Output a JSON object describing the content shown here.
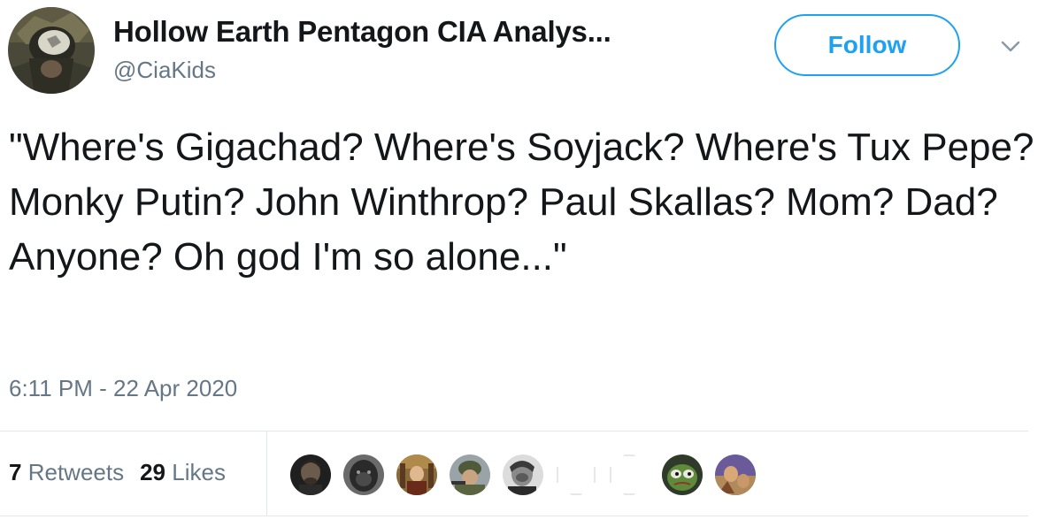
{
  "tweet": {
    "author": {
      "display_name": "Hollow Earth Pentagon CIA Analys...",
      "handle": "@CiaKids",
      "avatar_icon": "military-helmet-avatar"
    },
    "follow_label": "Follow",
    "menu_icon": "chevron-down-icon",
    "text": "\"Where's Gigachad? Where's Soyjack? Where's Tux Pepe? Monky Putin? John Winthrop? Paul Skallas? Mom? Dad? Anyone? Oh god I'm so alone...\"",
    "timestamp": "6:11 PM - 22 Apr 2020",
    "stats": {
      "retweets_count": "7",
      "retweets_label": "Retweets",
      "likes_count": "29",
      "likes_label": "Likes"
    },
    "liked_by_avatars": [
      "man-dark-avatar",
      "gorilla-avatar",
      "painting-avatar",
      "soldier-avatar",
      "bw-portrait-avatar",
      "blank-avatar",
      "blank-avatar",
      "pepe-avatar",
      "purple-painting-avatar"
    ]
  },
  "colors": {
    "accent": "#1da1f2",
    "text": "#14171a",
    "secondary": "#657786",
    "divider": "#e1e8ed"
  }
}
